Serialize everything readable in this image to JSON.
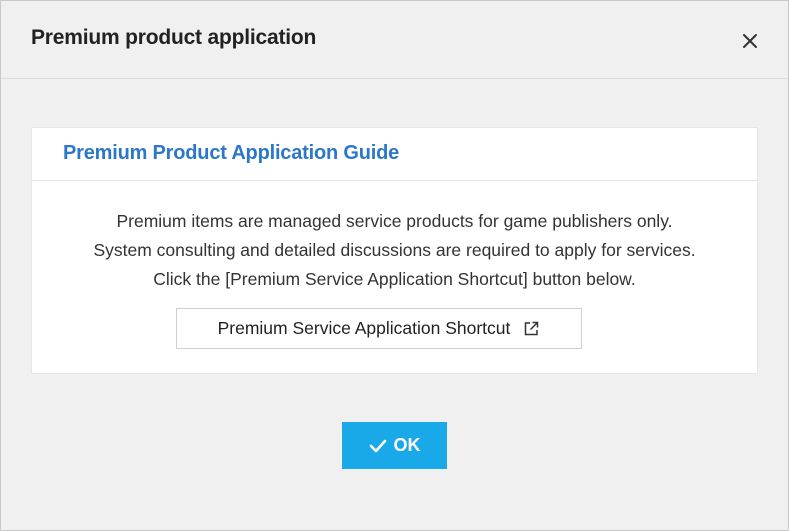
{
  "dialog": {
    "title": "Premium product application",
    "close_icon": "close-icon"
  },
  "guide": {
    "title": "Premium Product Application Guide",
    "lines": [
      "Premium items are managed service products for game publishers only.",
      "System consulting and detailed discussions are required to apply for services.",
      "Click the [Premium Service Application Shortcut] button below."
    ],
    "shortcut_button_label": "Premium Service Application Shortcut",
    "shortcut_icon": "external-link-icon"
  },
  "footer": {
    "ok_label": "OK",
    "ok_icon": "check-icon"
  },
  "colors": {
    "background": "#f0f0f0",
    "card": "#ffffff",
    "guide_title": "#2d77c8",
    "primary_button": "#1aa9e8"
  }
}
